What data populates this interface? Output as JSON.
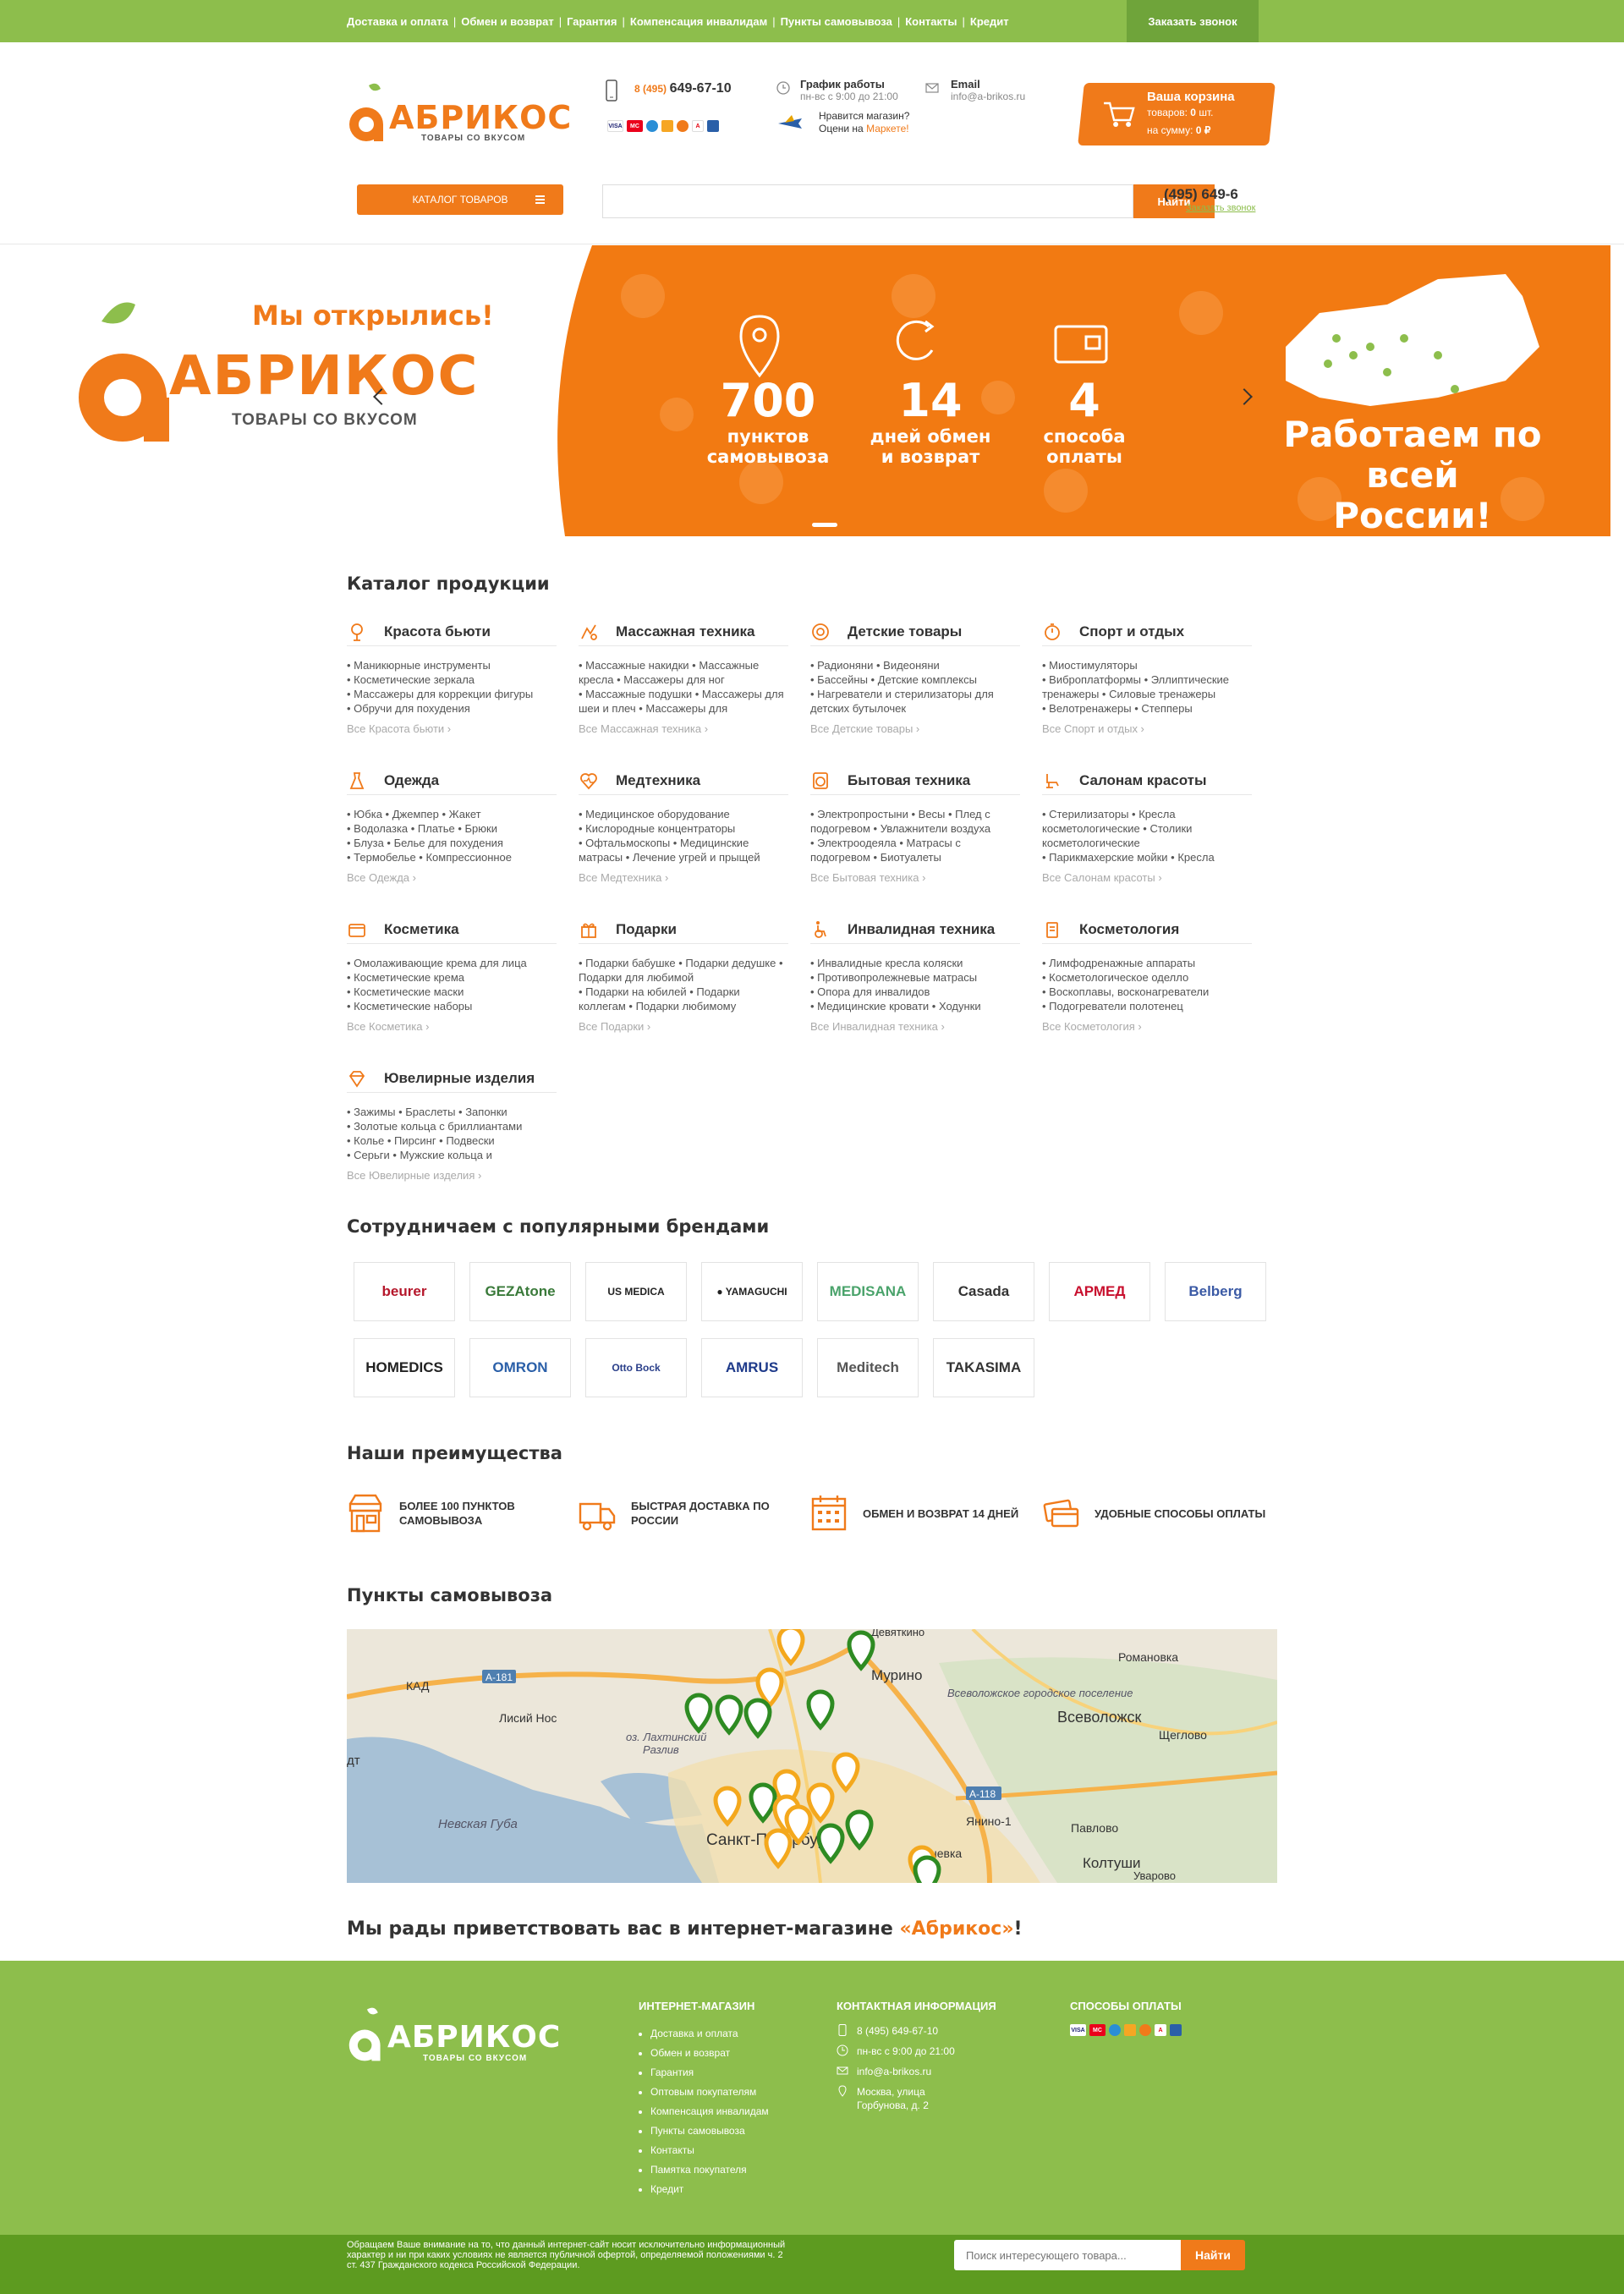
{
  "topbar": {
    "nav": [
      "Доставка и оплата",
      "Обмен и возврат",
      "Гарантия",
      "Компенсация инвалидам",
      "Пункты самовывоза",
      "Контакты",
      "Кредит"
    ],
    "call_button": "Заказать звонок"
  },
  "header": {
    "logo_text": "АБРИКОС",
    "logo_sub": "ТОВАРЫ СО ВКУСОМ",
    "phone_code": "8 (495)",
    "phone_number": "649-67-10",
    "schedule_title": "График работы",
    "schedule_value": "пн-вс с 9:00 до 21:00",
    "market_line1": "Нравится магазин?",
    "market_line2": "Оцени на",
    "market_link": "Маркете!",
    "email_title": "Email",
    "email_value": "info@a-brikos.ru",
    "cart_title": "Ваша корзина",
    "cart_items_label": "товаров:",
    "cart_items": "0",
    "cart_items_unit": "шт.",
    "cart_sum_label": "на сумму:",
    "cart_sum": "0 ₽",
    "catalog_button": "КАТАЛОГ ТОВАРОВ",
    "search_placeholder": "",
    "search_button": "Найти",
    "phone2": "(495) 649-6",
    "phone2_link": "Заказать звонок"
  },
  "banner": {
    "title": "Мы открылись!",
    "logo_text": "АБРИКОС",
    "logo_sub": "ТОВАРЫ СО ВКУСОМ",
    "stats": [
      {
        "n": "700",
        "l1": "пунктов",
        "l2": "самовывоза"
      },
      {
        "n": "14",
        "l1": "дней обмен",
        "l2": "и возврат"
      },
      {
        "n": "4",
        "l1": "способа",
        "l2": "оплаты"
      }
    ],
    "russia_line1": "Работаем по всей",
    "russia_line2": "России!"
  },
  "catalog": {
    "title": "Каталог продукции",
    "categories": [
      {
        "name": "Красота бьюти",
        "items": "• Маникюрные инструменты\n• Косметические зеркала\n• Массажеры для коррекции фигуры\n• Обручи для похудения",
        "all": "Все Красота бьюти ›",
        "icon": "beauty-icon"
      },
      {
        "name": "Массажная техника",
        "items": "• Массажные накидки • Массажные кресла • Массажеры для ног\n• Массажные подушки • Массажеры для шеи и плеч • Массажеры для",
        "all": "Все Массажная техника ›",
        "icon": "massage-icon"
      },
      {
        "name": "Детские товары",
        "items": "• Радионяни • Видеоняни\n• Бассейны • Детские комплексы\n• Нагреватели и стерилизаторы для детских бутылочек",
        "all": "Все Детские товары ›",
        "icon": "baby-icon"
      },
      {
        "name": "Спорт и отдых",
        "items": "• Миостимуляторы\n• Виброплатформы • Эллиптические тренажеры • Силовые тренажеры\n• Велотренажеры • Степперы",
        "all": "Все Спорт и отдых ›",
        "icon": "sport-icon"
      },
      {
        "name": "Одежда",
        "items": "• Юбка • Джемпер • Жакет\n• Водолазка • Платье • Брюки\n• Блуза • Белье для похудения\n• Термобелье • Компрессионное",
        "all": "Все Одежда ›",
        "icon": "dress-icon"
      },
      {
        "name": "Медтехника",
        "items": "• Медицинское оборудование\n• Кислородные концентраторы\n• Офтальмоскопы • Медицинские матрасы • Лечение угрей и прыщей",
        "all": "Все Медтехника ›",
        "icon": "heart-pulse-icon"
      },
      {
        "name": "Бытовая техника",
        "items": "• Электропростыни • Весы • Плед с подогревом • Увлажнители воздуха\n• Электроодеяла • Матрасы с подогревом • Биотуалеты",
        "all": "Все Бытовая техника ›",
        "icon": "washer-icon"
      },
      {
        "name": "Салонам красоты",
        "items": "• Стерилизаторы • Кресла косметологические • Столики косметологические\n• Парикмахерские мойки • Кресла",
        "all": "Все Салонам красоты ›",
        "icon": "salon-chair-icon"
      },
      {
        "name": "Косметика",
        "items": "• Омолаживающие крема для лица\n• Косметические крема\n• Косметические маски\n• Косметические наборы",
        "all": "Все Косметика ›",
        "icon": "cosmetics-icon"
      },
      {
        "name": "Подарки",
        "items": "• Подарки бабушке • Подарки дедушке • Подарки для любимой\n• Подарки на юбилей • Подарки коллегам • Подарки любимому",
        "all": "Все Подарки ›",
        "icon": "gift-icon"
      },
      {
        "name": "Инвалидная техника",
        "items": "• Инвалидные кресла коляски\n• Противопролежневые матрасы\n• Опора для инвалидов\n• Медицинские кровати • Ходунки",
        "all": "Все Инвалидная техника ›",
        "icon": "wheelchair-icon"
      },
      {
        "name": "Косметология",
        "items": "• Лимфодренажные аппараты\n• Косметологическое оделло\n• Воскоплавы, восконагреватели\n• Подогреватели полотенец",
        "all": "Все Косметология ›",
        "icon": "cosmetology-icon"
      },
      {
        "name": "Ювелирные изделия",
        "items": "• Зажимы • Браслеты • Запонки\n• Золотые кольца с бриллиантами\n• Колье • Пирсинг • Подвески\n• Серьги • Мужские кольца и",
        "all": "Все Ювелирные изделия ›",
        "icon": "diamond-icon"
      }
    ]
  },
  "brands": {
    "title": "Сотрудничаем с популярными брендами",
    "items": [
      {
        "name": "beurer",
        "color": "#b5172b"
      },
      {
        "name": "GEZAtone",
        "color": "#3a7a3a"
      },
      {
        "name": "US MEDICA",
        "color": "#222"
      },
      {
        "name": "● YAMAGUCHI",
        "color": "#222"
      },
      {
        "name": "MEDISANA",
        "color": "#4aa36b"
      },
      {
        "name": "Casada",
        "color": "#333"
      },
      {
        "name": "АРМЕД",
        "color": "#c8102e"
      },
      {
        "name": "Belberg",
        "color": "#3b5aa5"
      },
      {
        "name": "HOMEDICS",
        "color": "#222"
      },
      {
        "name": "OMRON",
        "color": "#2a5fa8"
      },
      {
        "name": "Otto Bock",
        "color": "#2a3f8a"
      },
      {
        "name": "AMRUS",
        "color": "#1e3a8a"
      },
      {
        "name": "Meditech",
        "color": "#555"
      },
      {
        "name": "TAKASIMA",
        "color": "#333"
      }
    ]
  },
  "advantages": {
    "title": "Наши преимущества",
    "items": [
      {
        "l1": "БОЛЕЕ 100 ПУНКТОВ",
        "l2": "САМОВЫВОЗА",
        "icon": "shop-icon"
      },
      {
        "l1": "БЫСТРАЯ ДОСТАВКА ПО",
        "l2": "РОССИИ",
        "icon": "truck-icon"
      },
      {
        "l1": "ОБМЕН И ВОЗВРАТ 14 ДНЕЙ",
        "l2": "",
        "icon": "calendar-icon"
      },
      {
        "l1": "УДОБНЫЕ СПОСОБЫ ОПЛАТЫ",
        "l2": "",
        "icon": "card-icon"
      }
    ]
  },
  "pickup": {
    "title": "Пункты самовывоза",
    "map_labels": {
      "murino": "Мурино",
      "vsevolozhsk": "Всеволожск",
      "spb": "Санкт-Петербург",
      "neva_bay": "Невская Губа",
      "koltushi": "Колтуши",
      "yanino": "Янино-1",
      "pavlovo": "Павлово",
      "romanovka": "Романовка",
      "shchegolovo": "Щеглово",
      "lisiy_nos": "Лисий Нос",
      "razliv": "Разлив",
      "ozero": "оз. Лахтинский",
      "kad": "КАД",
      "a181": "А-181",
      "a118": "А-118",
      "uvarovo": "Уварово",
      "devyatkino": "Девяткино",
      "vsevolozhsk_settlement": "Всеволожское городское поселение",
      "dt": "дт",
      "kovsk": "невка"
    }
  },
  "welcome": {
    "text": "Мы рады приветствовать вас в интернет-магазине ",
    "brand": "«Абрикос»",
    "end": "!"
  },
  "footer": {
    "logo_text": "АБРИКОС",
    "logo_sub": "ТОВАРЫ СО ВКУСОМ",
    "shop_title": "ИНТЕРНЕТ-МАГАЗИН",
    "shop_links": [
      "Доставка и оплата",
      "Обмен и возврат",
      "Гарантия",
      "Оптовым покупателям",
      "Компенсация инвалидам",
      "Пункты самовывоза",
      "Контакты",
      "Памятка покупателя",
      "Кредит"
    ],
    "contacts_title": "КОНТАКТНАЯ ИНФОРМАЦИЯ",
    "phone": "8 (495) 649-67-10",
    "hours": "пн-вс с 9:00 до 21:00",
    "email": "info@a-brikos.ru",
    "address1": "Москва, улица",
    "address2": "Горбунова, д. 2",
    "payment_title": "СПОСОБЫ ОПЛАТЫ",
    "disclaimer": "Обращаем Ваше внимание на то, что данный интернет-сайт носит исключительно информационный характер и ни при каких условиях не является публичной офертой, определяемой положениями ч. 2 ст. 437 Гражданского кодекса Российской Федерации.",
    "search_placeholder": "Поиск интересующего товара...",
    "search_button": "Найти"
  },
  "colors": {
    "green": "#8dbe4c",
    "orange": "#f07a1a",
    "dark_green": "#5d9b20"
  }
}
